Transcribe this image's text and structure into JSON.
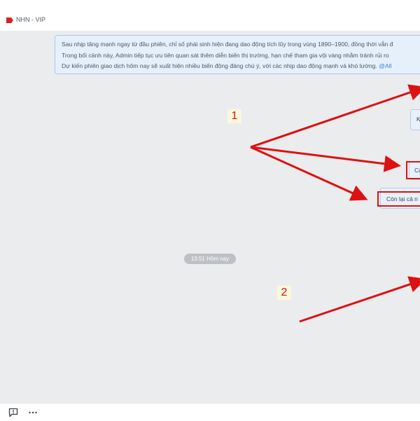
{
  "header": {
    "title": "NHN - VIP",
    "tag_color": "#dd1f1f"
  },
  "message": {
    "lines": [
      "Sau nhịp tăng mạnh ngay từ đầu phiên, chỉ số phái sinh hiện đang dao động tích lũy trong vùng 1890–1900, đồng thời vẫn đ",
      "Trong bối cảnh này, Admin tiếp tục ưu tiên quan sát thêm diễn biến thị trường, hạn chế tham gia vội vàng nhằm tránh rủi ro",
      "Dự kiến phiên giao dịch hôm nay sẽ xuất hiện nhiều biến động đáng chú ý, với các nhịp dao động mạnh và khó lường."
    ],
    "mention": "@All"
  },
  "side_bubbles": {
    "k_text": "K",
    "c_text": "Cả",
    "conlai_text": "Còn lại cả n"
  },
  "time_pill": "13:51 Hôm nay",
  "annotations": {
    "label_1": "1",
    "label_2": "2",
    "arrow_color": "#dd1111"
  },
  "footer": {
    "feedback_icon": "feedback-icon",
    "more_icon": "more-icon"
  }
}
